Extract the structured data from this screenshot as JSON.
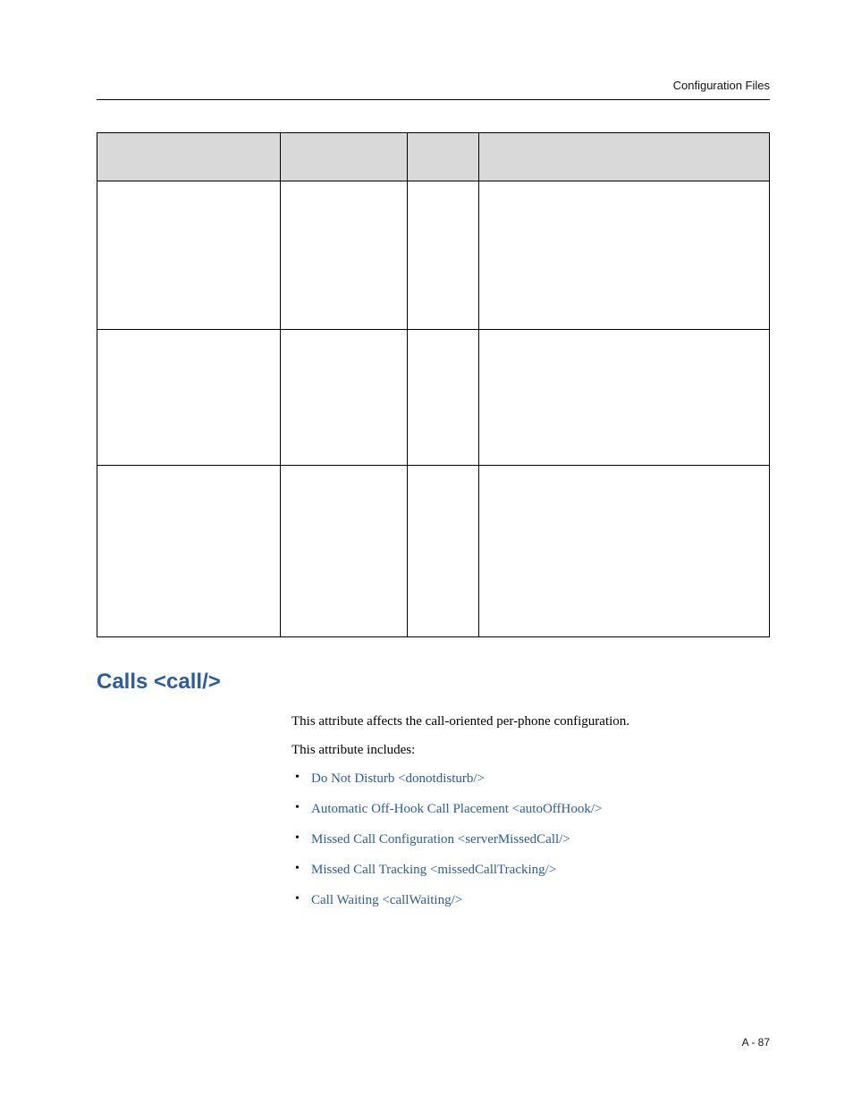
{
  "header": {
    "right_text": "Configuration Files"
  },
  "section": {
    "heading": "Calls <call/>",
    "intro_1": "This attribute affects the call-oriented per-phone configuration.",
    "intro_2": "This attribute includes:",
    "links": [
      "Do Not Disturb <donotdisturb/>",
      "Automatic Off-Hook Call Placement <autoOffHook/>",
      "Missed Call Configuration <serverMissedCall/>",
      "Missed Call Tracking <missedCallTracking/>",
      "Call Waiting <callWaiting/>"
    ]
  },
  "footer": {
    "page_num": "A - 87"
  }
}
